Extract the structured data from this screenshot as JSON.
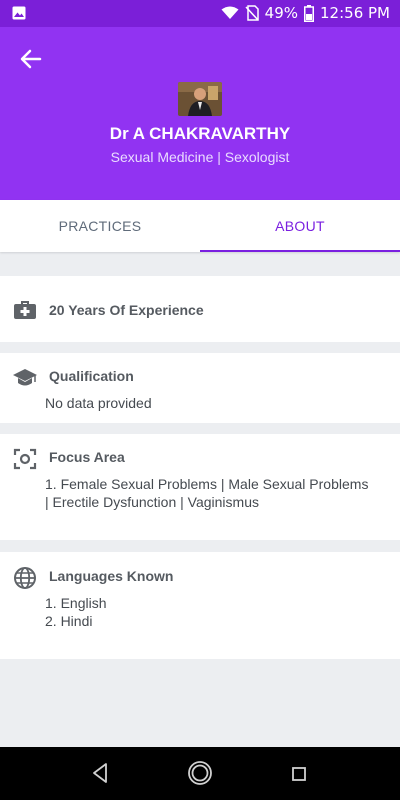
{
  "status_bar": {
    "battery": "49%",
    "time": "12:56 PM"
  },
  "header": {
    "doctor_name": "Dr A CHAKRAVARTHY",
    "specialty": "Sexual Medicine | Sexologist"
  },
  "tabs": [
    {
      "label": "PRACTICES",
      "active": false
    },
    {
      "label": "ABOUT",
      "active": true
    }
  ],
  "experience": {
    "text": "20 Years Of Experience",
    "icon": "medical-kit-icon"
  },
  "qualification": {
    "title": "Qualification",
    "body": "No data provided",
    "icon": "graduation-cap-icon"
  },
  "focus_area": {
    "title": "Focus Area",
    "body": "1. Female Sexual Problems | Male Sexual Problems | Erectile Dysfunction |  Vaginismus",
    "icon": "focus-icon"
  },
  "languages": {
    "title": "Languages Known",
    "items": [
      "1. English",
      "2. Hindi"
    ],
    "icon": "globe-icon"
  },
  "colors": {
    "header": "#9133f2",
    "status_bar": "#7b1fd8",
    "accent": "#7a1fe0"
  }
}
